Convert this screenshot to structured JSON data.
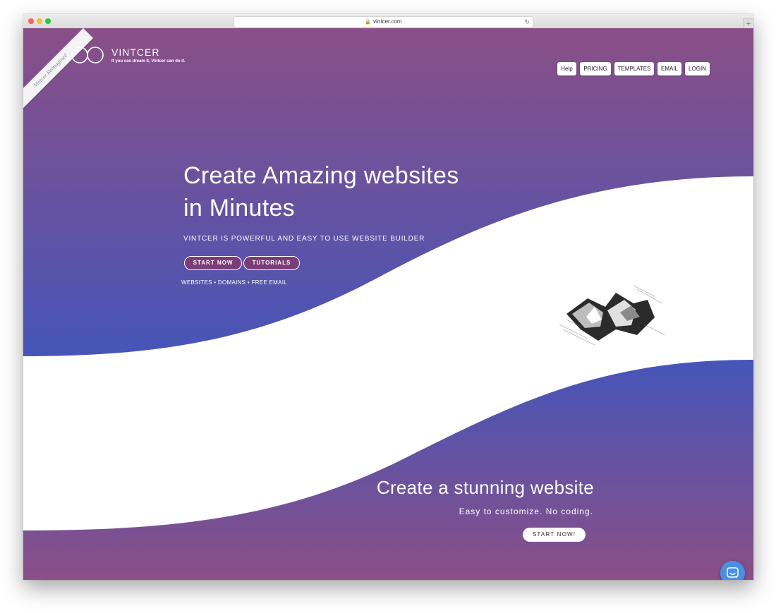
{
  "browser": {
    "url": "vintcer.com"
  },
  "ribbon": {
    "text": "Vintcer Reimagined"
  },
  "logo": {
    "name": "VINTCER",
    "tagline": "If you can dream it, Vintcer can do it."
  },
  "nav": {
    "items": [
      {
        "label": "Help"
      },
      {
        "label": "PRICING"
      },
      {
        "label": "TEMPLATES"
      },
      {
        "label": "EMAIL"
      },
      {
        "label": "LOGIN"
      }
    ]
  },
  "hero": {
    "title_line1": "Create Amazing websites",
    "title_line2": "in Minutes",
    "subtitle": "VINTCER IS POWERFUL AND EASY TO USE WEBSITE BUILDER",
    "start_button": "START NOW",
    "tutorials_button": "TUTORIALS",
    "links": "WEBSITES • DOMAINS • FREE EMAIL"
  },
  "lower": {
    "title": "Create a stunning website",
    "subtitle": "Easy to customize. No coding.",
    "button": "START NOW!"
  },
  "colors": {
    "purple": "#8a4f87",
    "indigo": "#4655b8",
    "white": "#ffffff",
    "chat_blue": "#4a90e2"
  },
  "icons": {
    "logo": "infinity-loops-icon",
    "chat": "chat-bubble-icon",
    "lock": "lock-icon",
    "reload": "reload-icon"
  }
}
